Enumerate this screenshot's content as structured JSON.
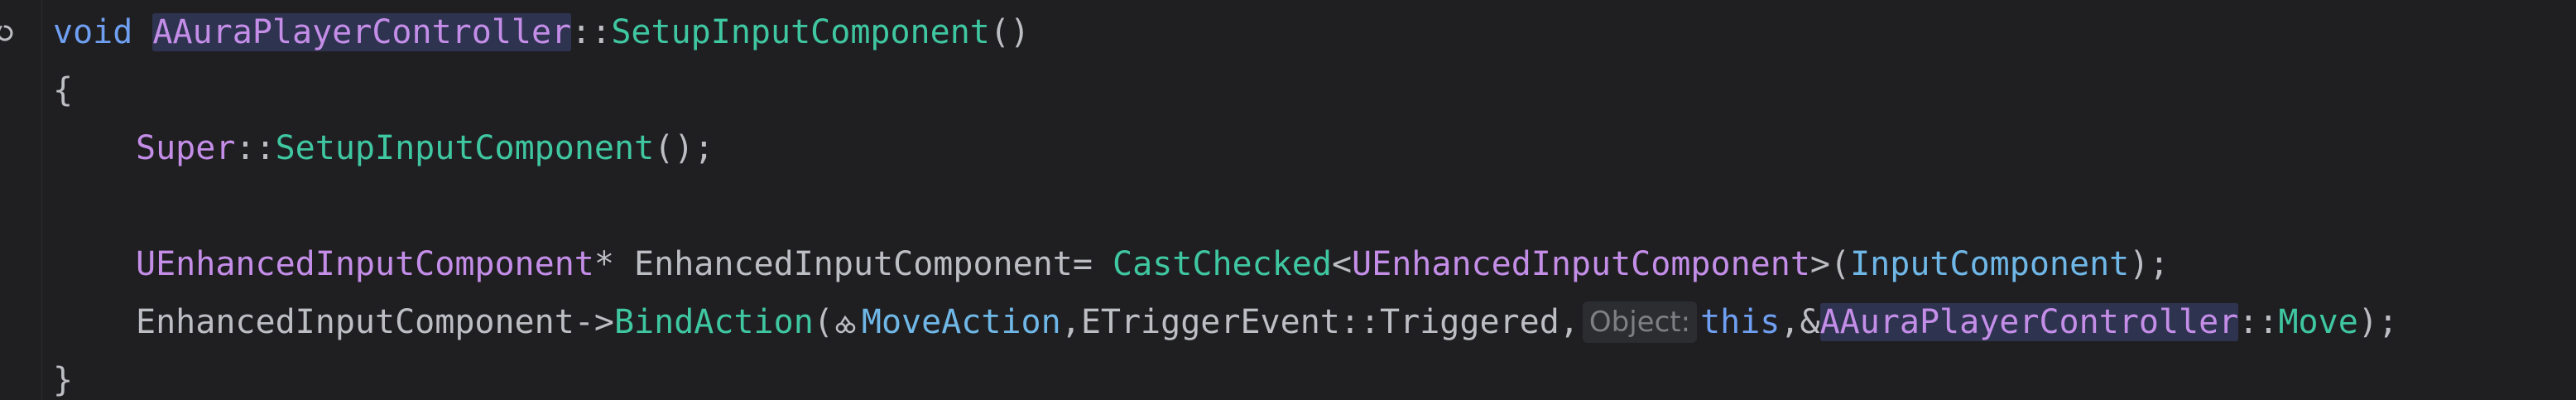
{
  "code": {
    "line1": {
      "kw_void": "void",
      "class_name": "AAuraPlayerController",
      "scope": "::",
      "func": "SetupInputComponent",
      "parens": "()"
    },
    "line2": {
      "brace": "{"
    },
    "line3": {
      "super": "Super",
      "scope": "::",
      "func": "SetupInputComponent",
      "tail": "();"
    },
    "line5": {
      "type": "UEnhancedInputComponent",
      "star_var": "* EnhancedInputComponent= ",
      "cast": "CastChecked",
      "lt": "<",
      "type2": "UEnhancedInputComponent",
      "gt_paren": ">(",
      "arg": "InputComponent",
      "tail": ");"
    },
    "line6": {
      "obj": "EnhancedInputComponent->",
      "bind": "BindAction",
      "open": "(",
      "move_action": "MoveAction",
      "comma1": ",",
      "trigger": "ETriggerEvent::Triggered,",
      "hint_label": "Object:",
      "this_kw": "this",
      "comma_amp": ",&",
      "class_name": "AAuraPlayerController",
      "scope": "::",
      "move": "Move",
      "tail": ");"
    },
    "line7": {
      "brace": "}"
    }
  },
  "icons": {
    "gutter": "override-marker-icon",
    "hint": "input-action-icon"
  },
  "colors": {
    "background": "#1f1f22",
    "keyword": "#6f9ff1",
    "class": "#c48ee8",
    "function": "#3fc7a1",
    "parameter": "#6fb7e6",
    "text": "#bcbec4",
    "highlight": "#2e3350"
  }
}
